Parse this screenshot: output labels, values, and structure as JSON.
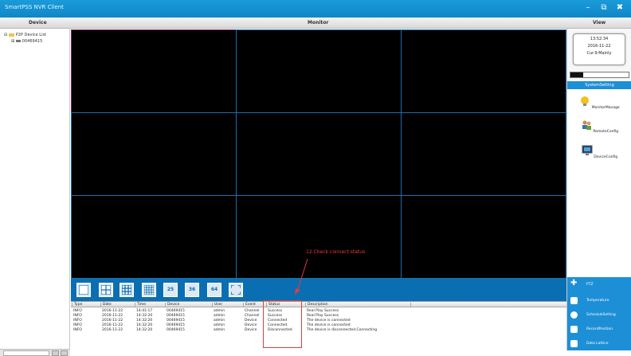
{
  "window": {
    "title": "SmartPSS NVR Client"
  },
  "header": {
    "device": "Device",
    "monitor": "Monitor",
    "view": "View"
  },
  "tree": {
    "root": "P2P Device List",
    "device": "00469415"
  },
  "clock": {
    "time": "13:52:34",
    "date": "2016-11-22",
    "status": "Cur.9:Mainly"
  },
  "meter": {
    "level": 0.22
  },
  "system": {
    "title": "SystemSetting",
    "items": [
      "MonitorManage",
      "RemoteConfig",
      "DeviceConfig"
    ]
  },
  "nav": {
    "ptz": "PTZ",
    "items": [
      "Temperature",
      "ScheduleSetting",
      "RecordPosition",
      "Data Lattice"
    ]
  },
  "toolbar": {
    "layouts": [
      "1",
      "4",
      "9",
      "16",
      "25",
      "36",
      "64",
      "full"
    ]
  },
  "annotation": {
    "text": "12.Check connect status"
  },
  "log": {
    "columns": [
      "Type",
      "Date",
      "Time",
      "Device",
      "User",
      "Event",
      "Status",
      "Description"
    ],
    "rows": [
      [
        "INFO",
        "2016-11-22",
        "14:41:17",
        "00469415",
        "admin",
        "Channel",
        "Success",
        "Real Play Success"
      ],
      [
        "INFO",
        "2016-11-22",
        "14:32:20",
        "00469415",
        "admin",
        "Channel",
        "Success",
        "Real Play Success"
      ],
      [
        "INFO",
        "2016-11-22",
        "14:32:20",
        "00469415",
        "admin",
        "Device",
        "Connected",
        "The device is connected"
      ],
      [
        "INFO",
        "2016-11-22",
        "14:32:20",
        "00469415",
        "admin",
        "Device",
        "Connected",
        "The device is connected"
      ],
      [
        "INFO",
        "2016-11-22",
        "14:32:20",
        "00469415",
        "admin",
        "Device",
        "Disconnected",
        "The device is disconnected.Connecting"
      ]
    ]
  }
}
